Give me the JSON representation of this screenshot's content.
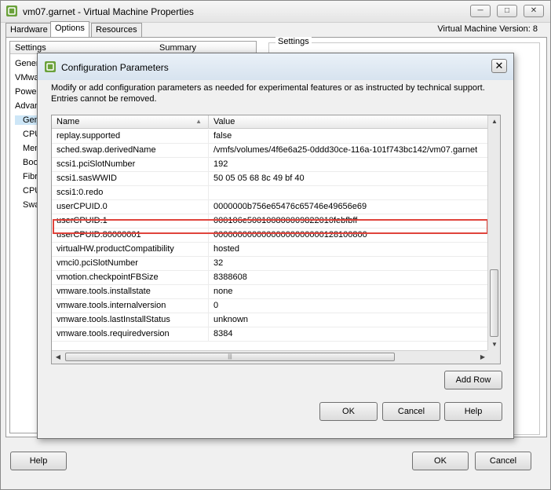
{
  "window": {
    "title": "vm07.garnet - Virtual Machine Properties",
    "vm_version": "Virtual Machine Version: 8",
    "tabs": [
      "Hardware",
      "Options",
      "Resources"
    ],
    "minimize_glyph": "─",
    "maximize_glyph": "□",
    "close_glyph": "✕"
  },
  "background_panel": {
    "col_settings": "Settings",
    "col_summary": "Summary",
    "items": [
      "Gener",
      "VMwa",
      "Power",
      "Advan",
      "Gen",
      "CPU",
      "Mem",
      "Boo",
      "Fibr",
      "CPU",
      "Swa"
    ],
    "right_group_title": "Settings"
  },
  "dialog": {
    "title": "Configuration Parameters",
    "close_glyph": "✕",
    "description": "Modify or add configuration parameters as needed for experimental features or as instructed by technical support. Entries cannot be removed.",
    "col_name": "Name",
    "col_value": "Value",
    "rows": [
      {
        "name": "replay.supported",
        "value": "false"
      },
      {
        "name": "sched.swap.derivedName",
        "value": "/vmfs/volumes/4f6e6a25-0ddd30ce-116a-101f743bc142/vm07.garnet"
      },
      {
        "name": "scsi1.pciSlotNumber",
        "value": "192"
      },
      {
        "name": "scsi1.sasWWID",
        "value": "50 05 05 68 8c 49 bf 40"
      },
      {
        "name": "scsi1:0.redo",
        "value": ""
      },
      {
        "name": "userCPUID.0",
        "value": "0000000b756e65476c65746e49656e69"
      },
      {
        "name": "userCPUID.1",
        "value": "000106e500100800009822010febfbff"
      },
      {
        "name": "userCPUID.80000001",
        "value": "00000000000000000000000128100800"
      },
      {
        "name": "virtualHW.productCompatibility",
        "value": "hosted"
      },
      {
        "name": "vmci0.pciSlotNumber",
        "value": "32"
      },
      {
        "name": "vmotion.checkpointFBSize",
        "value": "8388608"
      },
      {
        "name": "vmware.tools.installstate",
        "value": "none"
      },
      {
        "name": "vmware.tools.internalversion",
        "value": "0"
      },
      {
        "name": "vmware.tools.lastInstallStatus",
        "value": "unknown"
      },
      {
        "name": "vmware.tools.requiredversion",
        "value": "8384"
      }
    ],
    "highlighted_row": "scsi1.pciSlotNumber",
    "highlight_color": "#e0443c",
    "add_row_label": "Add Row",
    "ok_label": "OK",
    "cancel_label": "Cancel",
    "help_label": "Help"
  },
  "footer": {
    "help_label": "Help",
    "ok_label": "OK",
    "cancel_label": "Cancel"
  }
}
